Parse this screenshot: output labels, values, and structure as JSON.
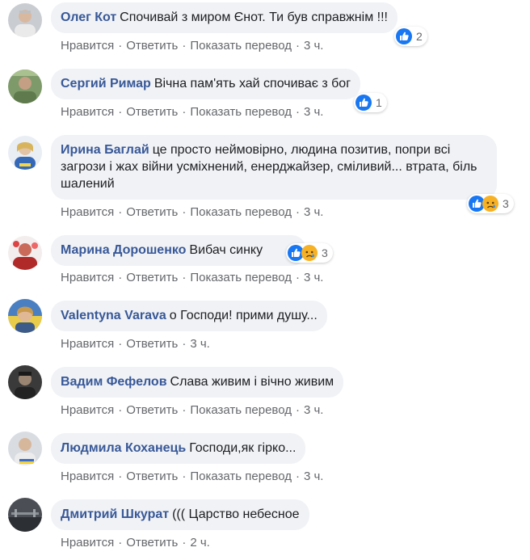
{
  "actions": {
    "like": "Нравится",
    "reply": "Ответить",
    "translate": "Показать перевод",
    "dot": "·"
  },
  "comments": [
    {
      "author": "Олег Кот",
      "text": "Спочивай з миром Єнот. Ти був справжнім !!!",
      "time": "3 ч.",
      "reactions": [
        "like-icon"
      ],
      "reaction_count": "2"
    },
    {
      "author": "Сергий Римар",
      "text": "Вічна пам'ять хай спочиває з бог",
      "time": "3 ч.",
      "reactions": [
        "like-icon"
      ],
      "reaction_count": "1"
    },
    {
      "author": "Ирина Баглай",
      "text": "це просто неймовірно, людина позитив, попри всі загрози і жах війни усміхнений, енерджайзер, сміливий... втрата, біль шалений",
      "time": "3 ч.",
      "reactions": [
        "like-icon",
        "sad-icon"
      ],
      "reaction_count": "3"
    },
    {
      "author": "Марина Дорошенко",
      "text": "Вибач синку",
      "time": "3 ч.",
      "reactions": [
        "like-icon",
        "sad-icon"
      ],
      "reaction_count": "3"
    },
    {
      "author": "Valentyna Varava",
      "text": "о Господи! прими душу...",
      "time": "3 ч.",
      "reactions": [],
      "reaction_count": ""
    },
    {
      "author": "Вадим Фефелов",
      "text": "Слава живим і вічно живим",
      "time": "3 ч.",
      "reactions": [],
      "reaction_count": ""
    },
    {
      "author": "Людмила Коханець",
      "text": "Господи,як гірко...",
      "time": "3 ч.",
      "reactions": [],
      "reaction_count": ""
    },
    {
      "author": "Дмитрий Шкурат",
      "text": "((( Царство небесное",
      "time": "2 ч.",
      "reactions": [],
      "reaction_count": ""
    }
  ],
  "colors": {
    "author": "#385898",
    "meta": "#65676b",
    "bubble": "#f0f2f5",
    "like_blue": "#1877f2",
    "sad_yellow": "#f7b125"
  }
}
